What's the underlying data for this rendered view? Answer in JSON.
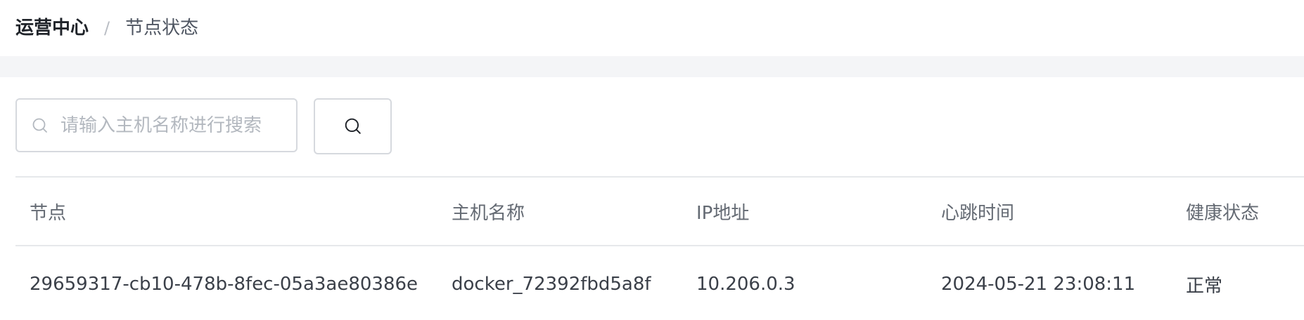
{
  "breadcrumb": {
    "root": "运营中心",
    "separator": "/",
    "current": "节点状态"
  },
  "search": {
    "placeholder": "请输入主机名称进行搜索",
    "value": "",
    "prefix_icon": "search-icon",
    "button_icon": "search-icon"
  },
  "table": {
    "columns": [
      "节点",
      "主机名称",
      "IP地址",
      "心跳时间",
      "健康状态"
    ],
    "rows": [
      {
        "node": "29659317-cb10-478b-8fec-05a3ae80386e",
        "hostname": "docker_72392fbd5a8f",
        "ip": "10.206.0.3",
        "heartbeat": "2024-05-21 23:08:11",
        "health": "正常"
      }
    ]
  },
  "colors": {
    "band": "#f4f5f7",
    "border": "#d6d9de",
    "placeholder": "#b3b8bf",
    "header_text": "#646a73"
  }
}
